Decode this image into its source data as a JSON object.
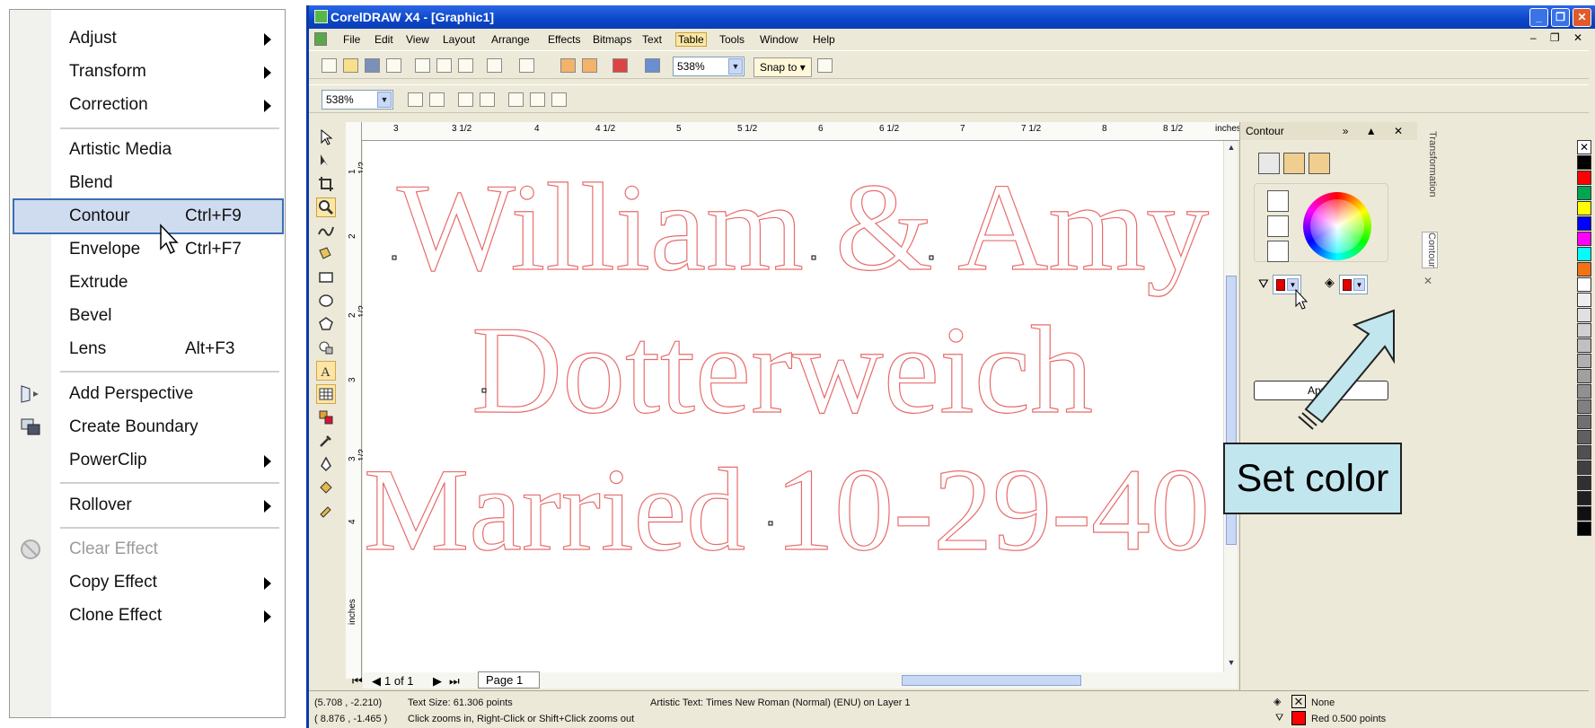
{
  "effects_menu": {
    "items": [
      {
        "label": "Adjust",
        "has_submenu": true
      },
      {
        "label": "Transform",
        "has_submenu": true
      },
      {
        "label": "Correction",
        "has_submenu": true
      },
      {
        "label": "Artistic Media"
      },
      {
        "label": "Blend"
      },
      {
        "label": "Contour",
        "shortcut": "Ctrl+F9",
        "highlighted": true
      },
      {
        "label": "Envelope",
        "shortcut": "Ctrl+F7"
      },
      {
        "label": "Extrude"
      },
      {
        "label": "Bevel"
      },
      {
        "label": "Lens",
        "shortcut": "Alt+F3"
      },
      {
        "label": "Add Perspective"
      },
      {
        "label": "Create Boundary"
      },
      {
        "label": "PowerClip",
        "has_submenu": true
      },
      {
        "label": "Rollover",
        "has_submenu": true
      },
      {
        "label": "Clear Effect",
        "disabled": true
      },
      {
        "label": "Copy Effect",
        "has_submenu": true
      },
      {
        "label": "Clone Effect",
        "has_submenu": true
      }
    ]
  },
  "window": {
    "title": "CorelDRAW X4 - [Graphic1]",
    "menus": [
      "File",
      "Edit",
      "View",
      "Layout",
      "Arrange",
      "Effects",
      "Bitmaps",
      "Text",
      "Table",
      "Tools",
      "Window",
      "Help"
    ]
  },
  "toolbar": {
    "zoom_value": "538%",
    "snap_label": "Snap to",
    "zoom_value2": "538%"
  },
  "ruler": {
    "h_ticks": [
      "3",
      "3 1/2",
      "4",
      "4 1/2",
      "5",
      "5 1/2",
      "6",
      "6 1/2",
      "7",
      "7 1/2",
      "8",
      "8 1/2",
      "inches"
    ],
    "v_ticks": [
      "1 1/2",
      "2",
      "2 1/2",
      "3",
      "3 1/2",
      "4"
    ],
    "unit": "inches"
  },
  "artwork": {
    "line1": "William & Amy",
    "line2": "Dotterweich",
    "line3": "Married 10-29-40",
    "outline_color": "#e86b6b"
  },
  "page_nav": {
    "count": "1 of 1",
    "page_tab": "Page 1"
  },
  "docker": {
    "title": "Contour",
    "apply_label": "Apply",
    "side_tabs": [
      "Transformation",
      "Contour"
    ]
  },
  "callout": {
    "text": "Set color",
    "fill": "#c2e6ee"
  },
  "palette": [
    "none",
    "#000000",
    "#ff0000",
    "#00a651",
    "#ffff00",
    "#0000ff",
    "#ff00ff",
    "#00ffff",
    "#f47216",
    "#ffffff",
    "#eeeeee",
    "#e0e0e0",
    "#d0d0d0",
    "#c0c0c0",
    "#b0b0b0",
    "#a0a0a0",
    "#909090",
    "#808080",
    "#707070",
    "#606060",
    "#505050",
    "#404040",
    "#303030",
    "#202020",
    "#101010",
    "#000000"
  ],
  "status": {
    "line1_coords": "(5.708 , -2.210)",
    "line1_text": "Text Size: 61.306 points",
    "line1_obj": "Artistic Text: Times New Roman (Normal) (ENU) on Layer 1",
    "line2_coords": "( 8.876 , -1.465 )",
    "line2_text": "Click zooms in, Right-Click or Shift+Click zooms out",
    "fill_label": "None",
    "outline_label": "Red  0.500 points",
    "outline_color": "#ff0000"
  }
}
